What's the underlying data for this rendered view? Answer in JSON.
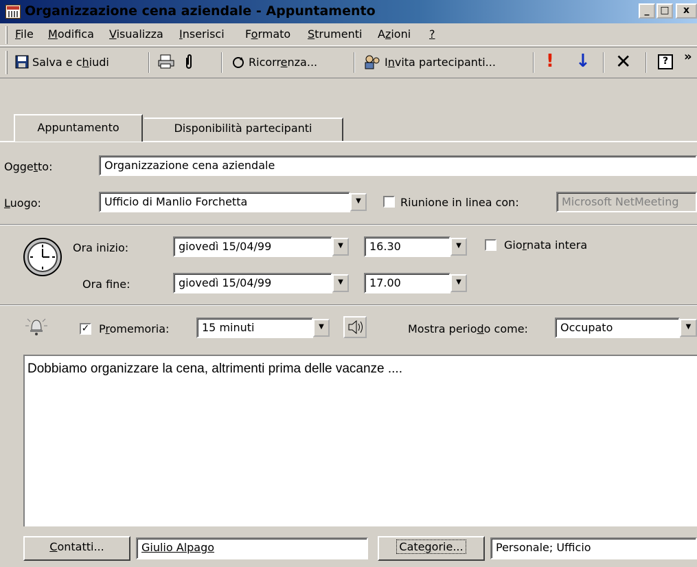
{
  "window": {
    "title": "Organizzazione cena aziendale - Appuntamento",
    "icon": "calendar-icon",
    "buttons": {
      "minimize": "_",
      "maximize": "□",
      "close": "x"
    }
  },
  "menu": [
    {
      "label": "File",
      "key": "F"
    },
    {
      "label": "Modifica",
      "key": "M"
    },
    {
      "label": "Visualizza",
      "key": "V"
    },
    {
      "label": "Inserisci",
      "key": "I"
    },
    {
      "label": "Formato",
      "key": "o"
    },
    {
      "label": "Strumenti",
      "key": "S"
    },
    {
      "label": "Azioni",
      "key": "z"
    },
    {
      "label": "?",
      "key": "?"
    }
  ],
  "toolbar": {
    "save_close": "Salva e chiudi",
    "recurrence": "Ricorrenza...",
    "invite": "Invita partecipanti...",
    "importance_high": "!",
    "importance_low": "↓",
    "delete": "✕",
    "help": "?",
    "more": "»"
  },
  "tabs": [
    {
      "label": "Appuntamento",
      "active": true
    },
    {
      "label": "Disponibilità partecipanti",
      "active": false
    }
  ],
  "form": {
    "subject_label": "Oggetto:",
    "subject_value": "Organizzazione cena aziendale",
    "location_label": "Luogo:",
    "location_value": "Ufficio di Manlio Forchetta",
    "online_label": "Riunione in linea con:",
    "online_checked": false,
    "online_value": "Microsoft NetMeeting",
    "start_label": "Ora inizio:",
    "start_date": "giovedì 15/04/99",
    "start_time": "16.30",
    "allday_label": "Giornata intera",
    "allday_checked": false,
    "end_label": "Ora fine:",
    "end_date": "giovedì 15/04/99",
    "end_time": "17.00",
    "reminder_label": "Promemoria:",
    "reminder_checked": true,
    "reminder_value": "15 minuti",
    "show_as_label": "Mostra periodo come:",
    "show_as_value": "Occupato",
    "notes": "Dobbiamo organizzare la cena, altrimenti prima delle vacanze ....",
    "contacts_button": "Contatti...",
    "contacts_value": "Giulio Alpago",
    "categories_button": "Categorie...",
    "categories_value": "Personale; Ufficio"
  }
}
